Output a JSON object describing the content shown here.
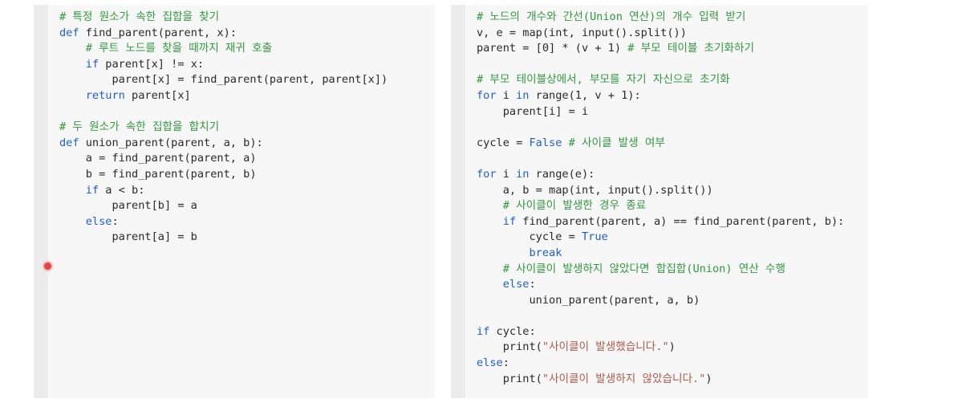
{
  "left_code": [
    [
      [
        "cm",
        "# 특정 원소가 속한 집합을 찾기"
      ]
    ],
    [
      [
        "kw",
        "def"
      ],
      [
        "nm",
        " find_parent(parent, x):"
      ]
    ],
    [
      [
        "nm",
        "    "
      ],
      [
        "cm",
        "# 루트 노드를 찾을 때까지 재귀 호출"
      ]
    ],
    [
      [
        "nm",
        "    "
      ],
      [
        "kw",
        "if"
      ],
      [
        "nm",
        " parent[x] != x:"
      ]
    ],
    [
      [
        "nm",
        "        parent[x] = find_parent(parent, parent[x])"
      ]
    ],
    [
      [
        "nm",
        "    "
      ],
      [
        "kw",
        "return"
      ],
      [
        "nm",
        " parent[x]"
      ]
    ],
    [
      [
        "nm",
        ""
      ]
    ],
    [
      [
        "cm",
        "# 두 원소가 속한 집합을 합치기"
      ]
    ],
    [
      [
        "kw",
        "def"
      ],
      [
        "nm",
        " union_parent(parent, a, b):"
      ]
    ],
    [
      [
        "nm",
        "    a = find_parent(parent, a)"
      ]
    ],
    [
      [
        "nm",
        "    b = find_parent(parent, b)"
      ]
    ],
    [
      [
        "nm",
        "    "
      ],
      [
        "kw",
        "if"
      ],
      [
        "nm",
        " a < b:"
      ]
    ],
    [
      [
        "nm",
        "        parent[b] = a"
      ]
    ],
    [
      [
        "nm",
        "    "
      ],
      [
        "kw",
        "else"
      ],
      [
        "nm",
        ":"
      ]
    ],
    [
      [
        "nm",
        "        parent[a] = b"
      ]
    ]
  ],
  "right_code": [
    [
      [
        "cm",
        "# 노드의 개수와 간선(Union 연산)의 개수 입력 받기"
      ]
    ],
    [
      [
        "nm",
        "v, e = map(int, input().split())"
      ]
    ],
    [
      [
        "nm",
        "parent = [0] * (v + 1) "
      ],
      [
        "cm",
        "# 부모 테이블 초기화하기"
      ]
    ],
    [
      [
        "nm",
        ""
      ]
    ],
    [
      [
        "cm",
        "# 부모 테이블상에서, 부모를 자기 자신으로 초기화"
      ]
    ],
    [
      [
        "kw",
        "for"
      ],
      [
        "nm",
        " i "
      ],
      [
        "kw",
        "in"
      ],
      [
        "nm",
        " range(1, v + 1):"
      ]
    ],
    [
      [
        "nm",
        "    parent[i] = i"
      ]
    ],
    [
      [
        "nm",
        ""
      ]
    ],
    [
      [
        "nm",
        "cycle = "
      ],
      [
        "lit",
        "False"
      ],
      [
        "nm",
        " "
      ],
      [
        "cm",
        "# 사이클 발생 여부"
      ]
    ],
    [
      [
        "nm",
        ""
      ]
    ],
    [
      [
        "kw",
        "for"
      ],
      [
        "nm",
        " i "
      ],
      [
        "kw",
        "in"
      ],
      [
        "nm",
        " range(e):"
      ]
    ],
    [
      [
        "nm",
        "    a, b = map(int, input().split())"
      ]
    ],
    [
      [
        "nm",
        "    "
      ],
      [
        "cm",
        "# 사이클이 발생한 경우 종료"
      ]
    ],
    [
      [
        "nm",
        "    "
      ],
      [
        "kw",
        "if"
      ],
      [
        "nm",
        " find_parent(parent, a) == find_parent(parent, b):"
      ]
    ],
    [
      [
        "nm",
        "        cycle = "
      ],
      [
        "lit",
        "True"
      ]
    ],
    [
      [
        "nm",
        "        "
      ],
      [
        "kw",
        "break"
      ]
    ],
    [
      [
        "nm",
        "    "
      ],
      [
        "cm",
        "# 사이클이 발생하지 않았다면 합집합(Union) 연산 수행"
      ]
    ],
    [
      [
        "nm",
        "    "
      ],
      [
        "kw",
        "else"
      ],
      [
        "nm",
        ":"
      ]
    ],
    [
      [
        "nm",
        "        union_parent(parent, a, b)"
      ]
    ],
    [
      [
        "nm",
        ""
      ]
    ],
    [
      [
        "kw",
        "if"
      ],
      [
        "nm",
        " cycle:"
      ]
    ],
    [
      [
        "nm",
        "    print("
      ],
      [
        "st",
        "\"사이클이 발생했습니다.\""
      ],
      [
        "nm",
        ")"
      ]
    ],
    [
      [
        "kw",
        "else"
      ],
      [
        "nm",
        ":"
      ]
    ],
    [
      [
        "nm",
        "    print("
      ],
      [
        "st",
        "\"사이클이 발생하지 않았습니다.\""
      ],
      [
        "nm",
        ")"
      ]
    ]
  ],
  "colors": {
    "keyword": "#1f5fd1",
    "comment": "#2f9a3c",
    "string": "#b25a4a",
    "text": "#2a2a2a",
    "breakpoint": "#e04646"
  }
}
